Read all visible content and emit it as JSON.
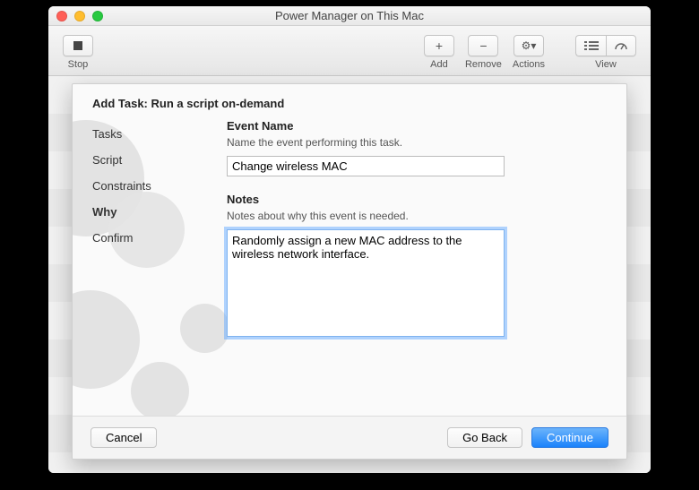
{
  "window": {
    "title": "Power Manager on This Mac"
  },
  "toolbar": {
    "stop": "Stop",
    "add": "Add",
    "remove": "Remove",
    "actions": "Actions",
    "view": "View"
  },
  "sheet": {
    "header": "Add Task: Run a script on-demand",
    "steps": [
      "Tasks",
      "Script",
      "Constraints",
      "Why",
      "Confirm"
    ],
    "activeStep": "Why",
    "eventName": {
      "label": "Event Name",
      "desc": "Name the event performing this task.",
      "value": "Change wireless MAC"
    },
    "notes": {
      "label": "Notes",
      "desc": "Notes about why this event is needed.",
      "value": "Randomly assign a new MAC address to the wireless network interface."
    },
    "buttons": {
      "cancel": "Cancel",
      "goBack": "Go Back",
      "continue": "Continue"
    }
  }
}
